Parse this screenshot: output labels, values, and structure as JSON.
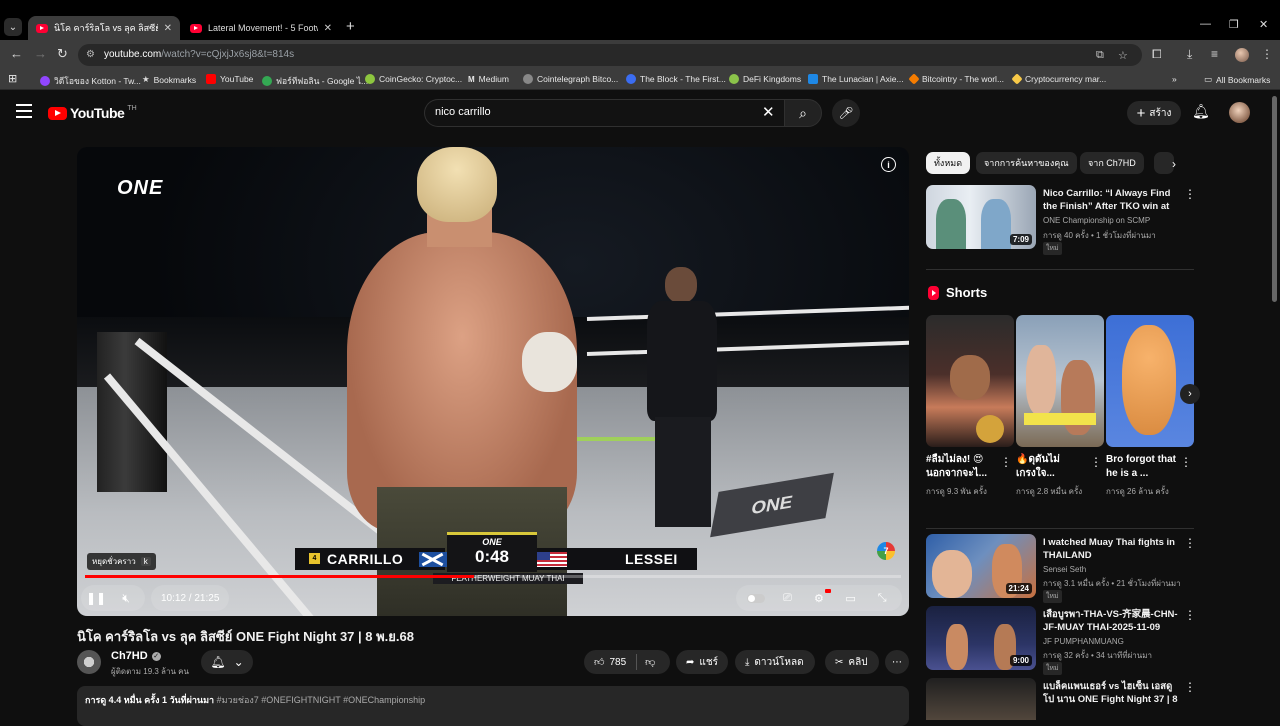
{
  "browser": {
    "tabs": [
      {
        "title": "นิโค คาร์ริลโล vs ลุค ลิสซีย์ ONE Fight Night"
      },
      {
        "title": "Lateral Movement! - 5 Footwork"
      }
    ],
    "url_host": "youtube.com",
    "url_path": "/watch?v=cQjxjJx6sj8&t=814s",
    "bookmarks": [
      {
        "label": "วิดีโอของ Kotton - Tw...",
        "color": "#9146ff"
      },
      {
        "label": "Bookmarks",
        "color": "#cccccc"
      },
      {
        "label": "YouTube",
        "color": "#ff0000"
      },
      {
        "label": "ฟอร์ทีฟอลิน - Google ไ...",
        "color": "#34a853"
      },
      {
        "label": "CoinGecko: Cryptoc...",
        "color": "#8dc63f"
      },
      {
        "label": "Medium",
        "color": "#ffffff"
      },
      {
        "label": "Cointelegraph Bitco...",
        "color": "#cccccc"
      },
      {
        "label": "The Block - The First...",
        "color": "#3b6df2"
      },
      {
        "label": "DeFi Kingdoms",
        "color": "#8bc34a"
      },
      {
        "label": "The Lunacian | Axie...",
        "color": "#1e88e5"
      },
      {
        "label": "Bitcointry - The worl...",
        "color": "#f57c00"
      },
      {
        "label": "Cryptocurrency mar...",
        "color": "#f7c948"
      }
    ],
    "all_bookmarks_label": "All Bookmarks"
  },
  "header": {
    "logo_text": "YouTube",
    "logo_country": "TH",
    "search_value": "nico carrillo",
    "create_label": "สร้าง"
  },
  "player": {
    "overlay_logo": "ONE",
    "score": {
      "left_fighter": "CARRILLO",
      "right_fighter": "LESSEI",
      "brand": "ONE",
      "clock": "0:48",
      "division": "FEATHERWEIGHT MUAY THAI",
      "left_number": "4"
    },
    "tooltip_label": "หยุดชั่วคราว",
    "tooltip_key": "k",
    "time_display": "10:12 / 21:25",
    "progress_fraction": 0.4763
  },
  "video": {
    "title": "นิโค คาร์ริลโล vs ลุค ลิสซีย์ ONE Fight Night 37 | 8 พ.ย.68",
    "channel_name": "Ch7HD",
    "subscribers": "ผู้ติดตาม 19.3 ล้าน คน",
    "likes": "785",
    "share_label": "แชร์",
    "download_label": "ดาวน์โหลด",
    "clip_label": "คลิป",
    "views_line": "การดู 4.4 หมื่น ครั้ง  1 วันที่ผ่านมา",
    "tags": "#มวยช่อง7 #ONEFIGHTNIGHT #ONEChampionship"
  },
  "sidebar": {
    "chips": [
      "ทั้งหมด",
      "จากการค้นหาของคุณ",
      "จาก Ch7HD"
    ],
    "top_rec": {
      "title": "Nico Carrillo: “I Always Find the Finish” After TKO win at ONE ...",
      "channel": "ONE Championship on SCMP",
      "meta": "การดู 40 ครั้ง • 1 ชั่วโมงที่ผ่านมา",
      "badge": "ใหม่",
      "duration": "7:09"
    },
    "shorts_title": "Shorts",
    "shorts": [
      {
        "title": "#ลืมไม่ลง! 😍 นอกจากจะไ...",
        "views": "การดู 9.3 พัน ครั้ง"
      },
      {
        "title": "🔥ดุดันไม่เกรงใจ...",
        "views": "การดู 2.8 หมื่น ครั้ง"
      },
      {
        "title": "Bro forgot that he is a ...",
        "views": "การดู 26 ล้าน ครั้ง"
      }
    ],
    "recs": [
      {
        "title": "I watched Muay Thai fights in THAILAND",
        "channel": "Sensei Seth",
        "meta": "การดู 3.1 หมื่น ครั้ง • 21 ชั่วโมงที่ผ่านมา",
        "badge": "ใหม่",
        "duration": "21:24"
      },
      {
        "title": "เสือบูรพา-THA-VS-齐家晨-CHN-JF-MUAY THAI-2025-11-09",
        "channel": "JF PUMPHANMUANG",
        "meta": "การดู 32 ครั้ง • 34 นาทีที่ผ่านมา",
        "badge": "ใหม่",
        "duration": "9:00"
      },
      {
        "title": "แบล็คแพนเธอร์ vs ไฮเซ็น เอสดูโป นาน ONE Fight Night 37 | 8 ...",
        "channel": "",
        "meta": "",
        "badge": "",
        "duration": ""
      }
    ]
  }
}
